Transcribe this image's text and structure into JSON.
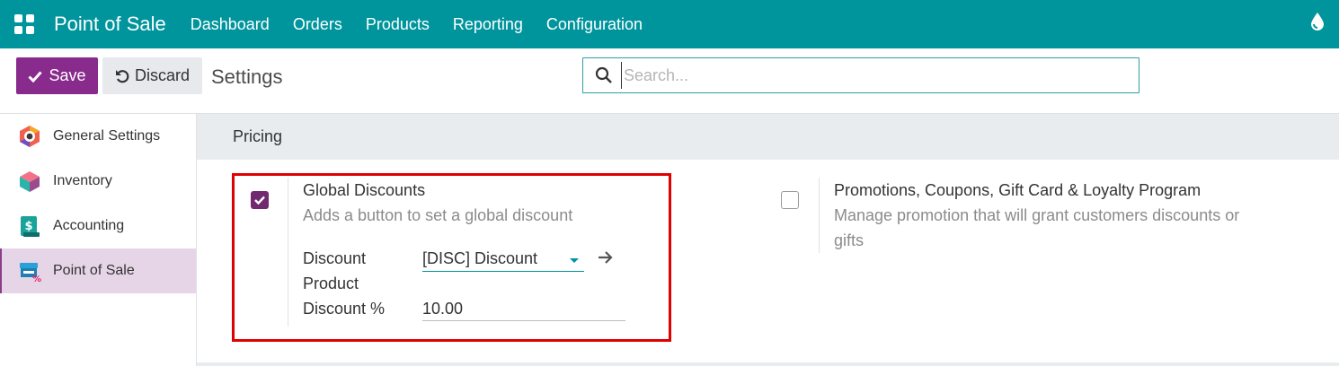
{
  "navbar": {
    "app_name": "Point of Sale",
    "menu": [
      "Dashboard",
      "Orders",
      "Products",
      "Reporting",
      "Configuration"
    ],
    "icons": {
      "apps": "grid-icon",
      "right": "water-drop-icon"
    }
  },
  "control": {
    "save_label": "Save",
    "discard_label": "Discard",
    "breadcrumb": "Settings",
    "search_placeholder": "Search..."
  },
  "sidebar": {
    "items": [
      {
        "label": "General Settings",
        "icon": "settings-hexagon-icon",
        "active": false
      },
      {
        "label": "Inventory",
        "icon": "inventory-box-icon",
        "active": false
      },
      {
        "label": "Accounting",
        "icon": "accounting-document-icon",
        "active": false
      },
      {
        "label": "Point of Sale",
        "icon": "point-of-sale-icon",
        "active": true
      }
    ]
  },
  "section": {
    "title": "Pricing"
  },
  "settings": {
    "global_discounts": {
      "checked": true,
      "title": "Global Discounts",
      "description": "Adds a button to set a global discount",
      "product_label_line1": "Discount",
      "product_label_line2": "Product",
      "product_value": "[DISC] Discount",
      "percent_label": "Discount %",
      "percent_value": "10.00"
    },
    "promotions": {
      "checked": false,
      "title": "Promotions, Coupons, Gift Card & Loyalty Program",
      "description_line1": "Manage promotion that will grant customers discounts or",
      "description_line2": "gifts"
    }
  },
  "colors": {
    "navbar": "#00949c",
    "primary": "#882b8c",
    "checkbox": "#71296f",
    "highlight_box": "#e00000",
    "sidebar_active": "#e6d5e7"
  }
}
